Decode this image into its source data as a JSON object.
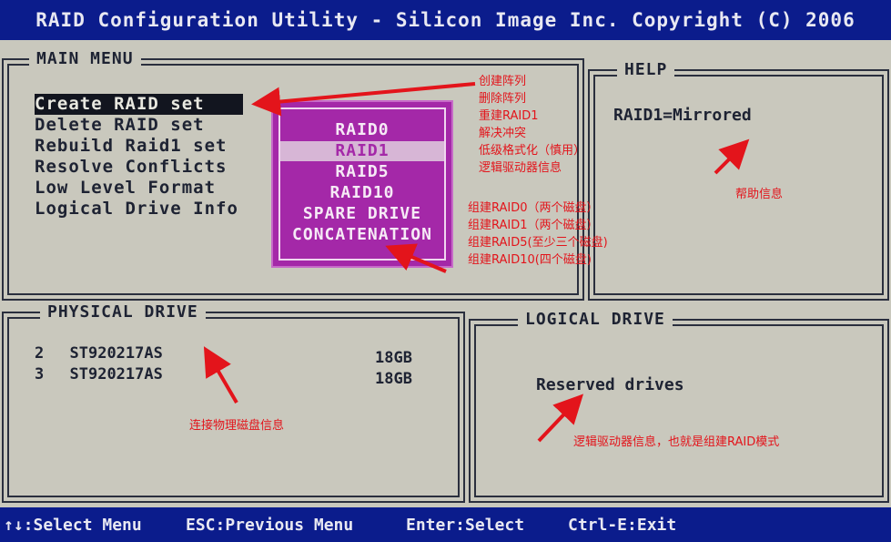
{
  "title": "RAID Configuration Utility - Silicon Image Inc. Copyright (C) 2006",
  "main_menu": {
    "title": "MAIN MENU",
    "items": [
      "Create RAID set",
      "Delete RAID set",
      "Rebuild Raid1 set",
      "Resolve Conflicts",
      "Low Level Format",
      "Logical Drive Info"
    ],
    "selected_index": 0
  },
  "raid_popup": {
    "items": [
      "RAID0",
      "RAID1",
      "RAID5",
      "RAID10",
      "SPARE DRIVE",
      "CONCATENATION"
    ],
    "selected_index": 1
  },
  "help": {
    "title": "HELP",
    "text": "RAID1=Mirrored"
  },
  "physical_drive": {
    "title": "PHYSICAL DRIVE",
    "drives": [
      {
        "id": "2",
        "model": "ST920217AS",
        "size": "18GB"
      },
      {
        "id": "3",
        "model": "ST920217AS",
        "size": "18GB"
      }
    ]
  },
  "logical_drive": {
    "title": "LOGICAL DRIVE",
    "text": "Reserved drives"
  },
  "status_bar": {
    "select_menu": "↑↓:Select Menu",
    "previous_menu": "ESC:Previous Menu",
    "enter_select": "Enter:Select",
    "exit": "Ctrl-E:Exit"
  },
  "annotations": {
    "menu_notes": [
      "创建阵列",
      "删除阵列",
      "重建RAID1",
      "解决冲突",
      "低级格式化（慎用）",
      "逻辑驱动器信息"
    ],
    "raid_notes": [
      "组建RAID0（两个磁盘）",
      "组建RAID1（两个磁盘）",
      "组建RAID5(至少三个磁盘)",
      "组建RAID10(四个磁盘)"
    ],
    "help_note": "帮助信息",
    "physical_note": "连接物理磁盘信息",
    "logical_note": "逻辑驱动器信息，也就是组建RAID模式"
  },
  "colors": {
    "bios_blue": "#0b1c8c",
    "screen_bg": "#c9c8bd",
    "popup_magenta": "#a428a8",
    "annotation_red": "#e3141b"
  }
}
